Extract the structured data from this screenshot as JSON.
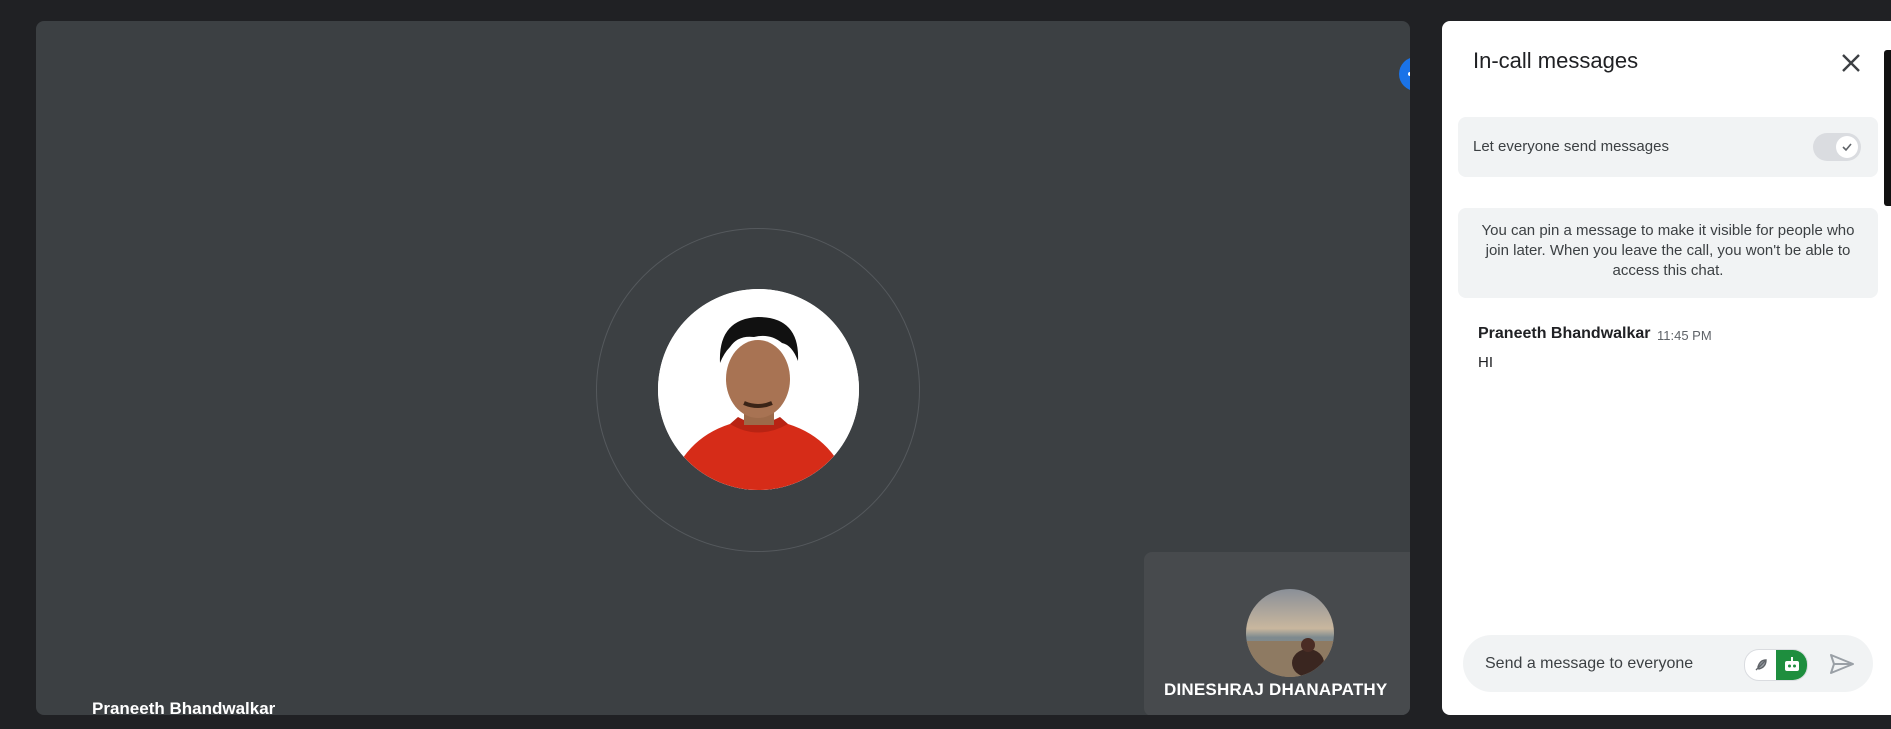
{
  "stage": {
    "presenter_name": "Praneeth Bhandwalkar",
    "more_options_icon": "more-horizontal-icon",
    "tile_name": "DINESHRAJ DHANAPATHY"
  },
  "panel": {
    "title": "In-call messages",
    "close_icon": "close-icon",
    "toggle_label": "Let everyone send messages",
    "toggle_on": true,
    "info_text": "You can pin a message to make it visible for people who join later. When you leave the call, you won't be able to access this chat.",
    "messages": [
      {
        "sender": "Praneeth Bhandwalkar",
        "time": "11:45 PM",
        "text": "HI"
      }
    ],
    "compose_placeholder": "Send a message to everyone"
  },
  "colors": {
    "accent": "#1a73e8",
    "stage_bg": "#3c4043",
    "page_bg": "#202124",
    "tool_green": "#1e8e3e"
  }
}
